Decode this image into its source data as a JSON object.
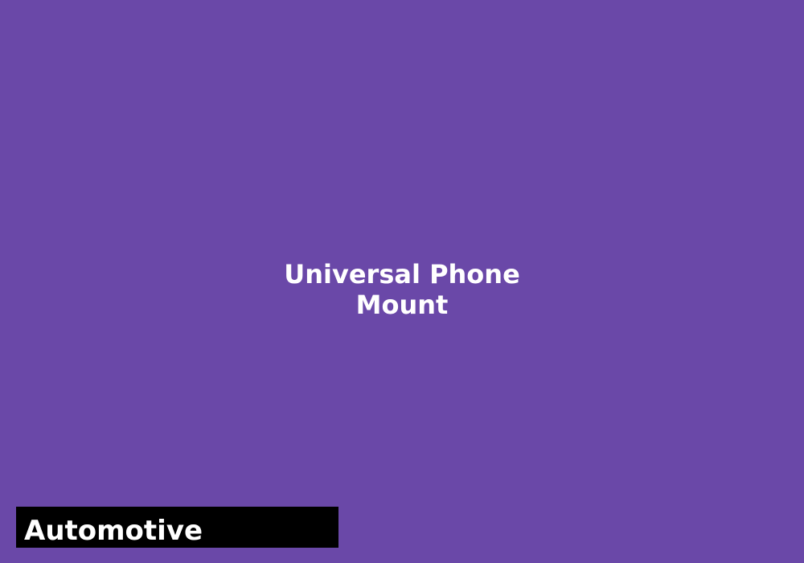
{
  "colors": {
    "background": "#6a48a8",
    "title_text": "#ffffff",
    "category_background": "#000000",
    "category_text": "#ffffff"
  },
  "product": {
    "title_line_1": "Universal Phone",
    "title_line_2": "Mount"
  },
  "category": {
    "label": "Automotive"
  }
}
